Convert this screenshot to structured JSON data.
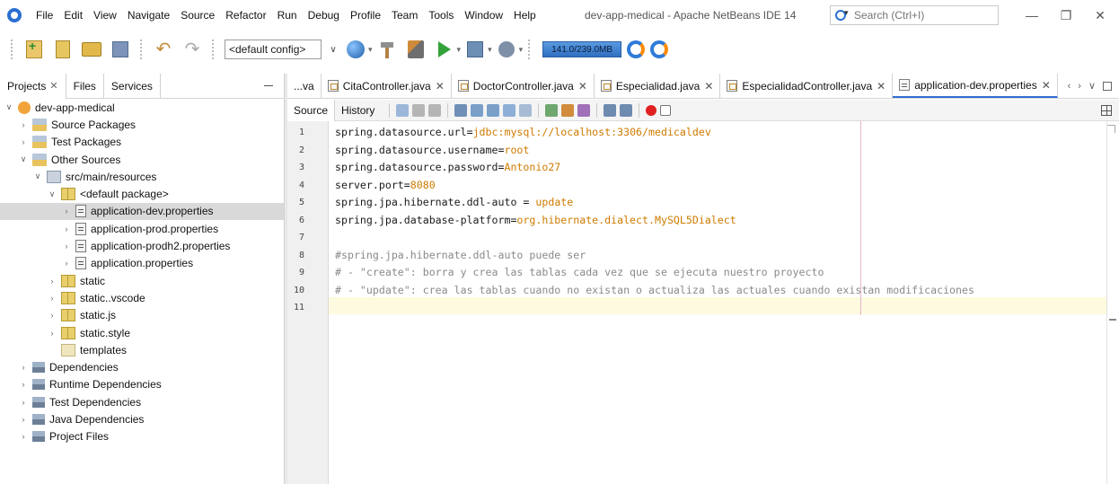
{
  "menu": [
    "File",
    "Edit",
    "View",
    "Navigate",
    "Source",
    "Refactor",
    "Run",
    "Debug",
    "Profile",
    "Team",
    "Tools",
    "Window",
    "Help"
  ],
  "window_title": "dev-app-medical - Apache NetBeans IDE 14",
  "search": {
    "placeholder": "Search (Ctrl+I)"
  },
  "window_controls": {
    "minimize": "—",
    "restore": "❐",
    "close": "✕"
  },
  "toolbar": {
    "config_value": "<default config>",
    "memory": "141.0/239.0MB"
  },
  "left_tabs": [
    {
      "label": "Projects",
      "close": "✕"
    },
    {
      "label": "Files"
    },
    {
      "label": "Services"
    }
  ],
  "tree": [
    {
      "label": "dev-app-medical",
      "indent": 0,
      "twisty": "∨",
      "icon": "project-icon",
      "cls": "project"
    },
    {
      "label": "Source Packages",
      "indent": 1,
      "twisty": "›",
      "icon": "source-packages-icon",
      "cls": "pkgdir"
    },
    {
      "label": "Test Packages",
      "indent": 1,
      "twisty": "›",
      "icon": "test-packages-icon",
      "cls": "pkgdir"
    },
    {
      "label": "Other Sources",
      "indent": 1,
      "twisty": "∨",
      "icon": "other-sources-icon",
      "cls": "pkgdir"
    },
    {
      "label": "src/main/resources",
      "indent": 2,
      "twisty": "∨",
      "icon": "source-folder-icon",
      "cls": "srcfolder"
    },
    {
      "label": "<default package>",
      "indent": 3,
      "twisty": "∨",
      "icon": "package-icon",
      "cls": "pkg"
    },
    {
      "label": "application-dev.properties",
      "indent": 4,
      "twisty": "›",
      "icon": "properties-file-icon",
      "cls": "prop",
      "selected": true
    },
    {
      "label": "application-prod.properties",
      "indent": 4,
      "twisty": "›",
      "icon": "properties-file-icon",
      "cls": "prop"
    },
    {
      "label": "application-prodh2.properties",
      "indent": 4,
      "twisty": "›",
      "icon": "properties-file-icon",
      "cls": "prop"
    },
    {
      "label": "application.properties",
      "indent": 4,
      "twisty": "›",
      "icon": "properties-file-icon",
      "cls": "prop"
    },
    {
      "label": "static",
      "indent": 3,
      "twisty": "›",
      "icon": "package-icon",
      "cls": "pkg"
    },
    {
      "label": "static..vscode",
      "indent": 3,
      "twisty": "›",
      "icon": "package-icon",
      "cls": "pkg"
    },
    {
      "label": "static.js",
      "indent": 3,
      "twisty": "›",
      "icon": "package-icon",
      "cls": "pkg"
    },
    {
      "label": "static.style",
      "indent": 3,
      "twisty": "›",
      "icon": "package-icon",
      "cls": "pkg"
    },
    {
      "label": "templates",
      "indent": 3,
      "twisty": "",
      "icon": "empty-package-icon",
      "cls": "pkg-empty"
    },
    {
      "label": "Dependencies",
      "indent": 1,
      "twisty": "›",
      "icon": "library-icon",
      "cls": "lib"
    },
    {
      "label": "Runtime Dependencies",
      "indent": 1,
      "twisty": "›",
      "icon": "library-icon",
      "cls": "lib"
    },
    {
      "label": "Test Dependencies",
      "indent": 1,
      "twisty": "›",
      "icon": "library-icon",
      "cls": "lib"
    },
    {
      "label": "Java Dependencies",
      "indent": 1,
      "twisty": "›",
      "icon": "library-icon",
      "cls": "lib"
    },
    {
      "label": "Project Files",
      "indent": 1,
      "twisty": "›",
      "icon": "project-files-icon",
      "cls": "lib"
    }
  ],
  "editor_tabs": [
    {
      "label": "...va",
      "plain": true
    },
    {
      "label": "CitaController.java",
      "icon": "java-file-icon"
    },
    {
      "label": "DoctorController.java",
      "icon": "java-file-icon"
    },
    {
      "label": "Especialidad.java",
      "icon": "java-file-icon"
    },
    {
      "label": "EspecialidadController.java",
      "icon": "java-file-icon"
    },
    {
      "label": "application-dev.properties",
      "icon": "properties-file-icon",
      "active": true
    }
  ],
  "tab_nav": {
    "prev": "‹",
    "next": "›",
    "list": "∨"
  },
  "editor_modes": [
    "Source",
    "History"
  ],
  "code_lines": [
    {
      "key": "spring.datasource.url=",
      "value": "jdbc:mysql://localhost:3306/medicaldev"
    },
    {
      "key": "spring.datasource.username=",
      "value": "root"
    },
    {
      "key": "spring.datasource.password=",
      "value": "Antonio27"
    },
    {
      "key": "server.port=",
      "value": "8080"
    },
    {
      "key": "spring.jpa.hibernate.ddl-auto = ",
      "value": "update"
    },
    {
      "key": "spring.jpa.database-platform=",
      "value": "org.hibernate.dialect.MySQL5Dialect"
    },
    {
      "key": "",
      "value": ""
    },
    {
      "comment": "#spring.jpa.hibernate.ddl-auto puede ser"
    },
    {
      "comment": "# - \"create\": borra y crea las tablas cada vez que se ejecuta nuestro proyecto"
    },
    {
      "comment": "# - \"update\": crea las tablas cuando no existan o actualiza las actuales cuando existan modificaciones"
    },
    {
      "key": "",
      "value": ""
    }
  ],
  "colors": {
    "value": "#ce7b00",
    "comment": "#8a8a8a",
    "accent": "#2f6fd1",
    "selection": "#d9d9d9",
    "current_line": "#fdfae0"
  }
}
